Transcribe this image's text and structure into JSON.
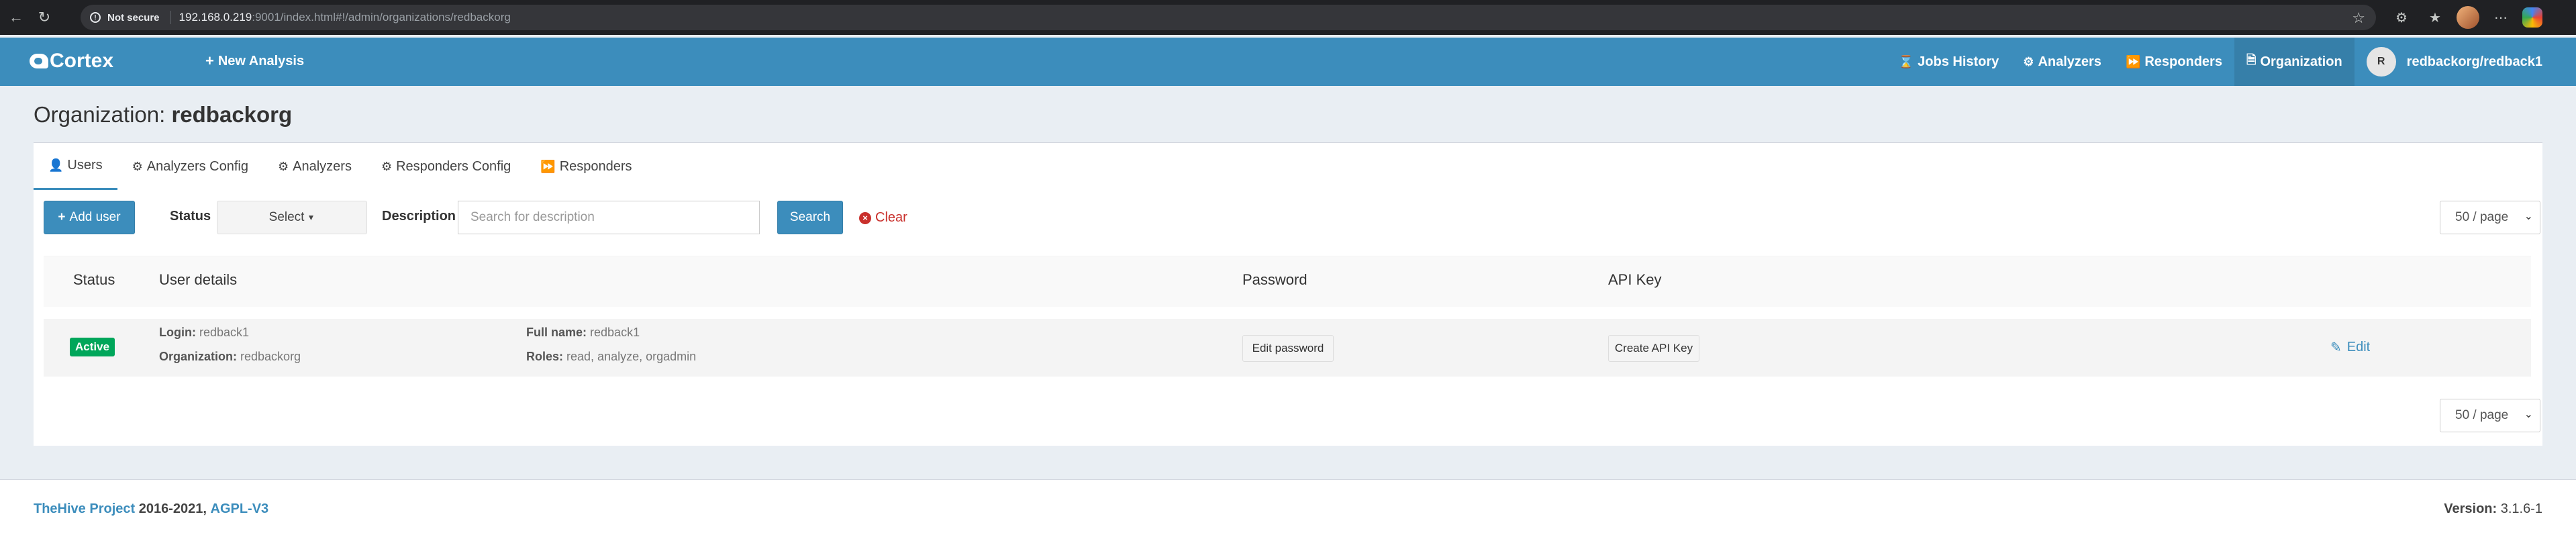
{
  "browser": {
    "security_label": "Not secure",
    "url_host": "192.168.0.219",
    "url_rest": ":9001/index.html#!/admin/organizations/redbackorg"
  },
  "navbar": {
    "brand": "Cortex",
    "new_analysis": "New Analysis",
    "items": [
      {
        "label": "Jobs History",
        "icon": "hourglass-icon"
      },
      {
        "label": "Analyzers",
        "icon": "cogs-icon"
      },
      {
        "label": "Responders",
        "icon": "fast-forward-icon"
      },
      {
        "label": "Organization",
        "icon": "file-icon"
      }
    ],
    "user_initial": "R",
    "user": "redbackorg/redback1"
  },
  "page": {
    "title_prefix": "Organization:",
    "title_name": "redbackorg"
  },
  "tabs": [
    {
      "label": "Users",
      "icon": "user-icon",
      "active": true
    },
    {
      "label": "Analyzers Config",
      "icon": "cog-icon"
    },
    {
      "label": "Analyzers",
      "icon": "cogs-icon"
    },
    {
      "label": "Responders Config",
      "icon": "cog-icon"
    },
    {
      "label": "Responders",
      "icon": "fast-forward-icon"
    }
  ],
  "filters": {
    "add_user": "Add user",
    "status_label": "Status",
    "status_select": "Select",
    "description_label": "Description",
    "description_placeholder": "Search for description",
    "search": "Search",
    "clear": "Clear",
    "page_size": "50 / page"
  },
  "table": {
    "headers": {
      "status": "Status",
      "details": "User details",
      "password": "Password",
      "api_key": "API Key"
    },
    "rows": [
      {
        "status": "Active",
        "login_label": "Login:",
        "login": "redback1",
        "org_label": "Organization:",
        "org": "redbackorg",
        "fullname_label": "Full name:",
        "fullname": "redback1",
        "roles_label": "Roles:",
        "roles": "read, analyze, orgadmin",
        "edit_password": "Edit password",
        "create_api_key": "Create API Key",
        "edit": "Edit"
      }
    ]
  },
  "colors": {
    "primary": "#3c8dbc",
    "success": "#00a65a",
    "danger": "#c9302c"
  },
  "footer": {
    "project": "TheHive Project",
    "years": "2016-2021,",
    "license": "AGPL-V3",
    "version_label": "Version:",
    "version": "3.1.6-1"
  }
}
